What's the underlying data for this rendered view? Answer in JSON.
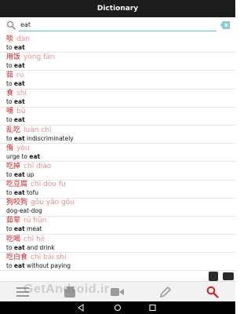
{
  "app": {
    "title": "Dictionary"
  },
  "search": {
    "value": "eat",
    "placeholder": ""
  },
  "colors": {
    "accent": "#d02020",
    "pinyin": "#e89090",
    "underline": "#55c0d8",
    "active_tab": "#d02020"
  },
  "entries": [
    {
      "hanzi": "啖",
      "pinyin": "dàn",
      "gloss_pre": "to ",
      "gloss_key": "eat",
      "gloss_post": ""
    },
    {
      "hanzi": "用饭",
      "pinyin": "yòng fàn",
      "gloss_pre": "to ",
      "gloss_key": "eat",
      "gloss_post": ""
    },
    {
      "hanzi": "茹",
      "pinyin": "rú",
      "gloss_pre": "to ",
      "gloss_key": "eat",
      "gloss_post": ""
    },
    {
      "hanzi": "食",
      "pinyin": "shí",
      "gloss_pre": "to ",
      "gloss_key": "eat",
      "gloss_post": ""
    },
    {
      "hanzi": "哺",
      "pinyin": "bǔ",
      "gloss_pre": "to ",
      "gloss_key": "eat",
      "gloss_post": ""
    },
    {
      "hanzi": "乱吃",
      "pinyin": "luàn chī",
      "gloss_pre": "to ",
      "gloss_key": "eat",
      "gloss_post": " indiscriminately"
    },
    {
      "hanzi": "侑",
      "pinyin": "yòu",
      "gloss_pre": "urge to ",
      "gloss_key": "eat",
      "gloss_post": ""
    },
    {
      "hanzi": "吃掉",
      "pinyin": "chī diào",
      "gloss_pre": "to ",
      "gloss_key": "eat",
      "gloss_post": " up"
    },
    {
      "hanzi": "吃豆腐",
      "pinyin": "chī dòu fu",
      "gloss_pre": "to ",
      "gloss_key": "eat",
      "gloss_post": " tofu"
    },
    {
      "hanzi": "狗咬狗",
      "pinyin": "gǒu yǎo gǒu",
      "gloss_pre": "dog-eat-dog",
      "gloss_key": "",
      "gloss_post": ""
    },
    {
      "hanzi": "茹荤",
      "pinyin": "rú hūn",
      "gloss_pre": "to ",
      "gloss_key": "eat",
      "gloss_post": " meat"
    },
    {
      "hanzi": "吃喝",
      "pinyin": "chī hē",
      "gloss_pre": "to ",
      "gloss_key": "eat",
      "gloss_post": " and drink"
    },
    {
      "hanzi": "吃白食",
      "pinyin": "chī bái shí",
      "gloss_pre": "to ",
      "gloss_key": "eat",
      "gloss_post": " without paying"
    }
  ],
  "tabs": [
    {
      "name": "tab-list",
      "icon": "list-icon"
    },
    {
      "name": "tab-flashcards",
      "icon": "cards-icon"
    },
    {
      "name": "tab-video",
      "icon": "video-icon"
    },
    {
      "name": "tab-write",
      "icon": "pencil-icon"
    },
    {
      "name": "tab-search",
      "icon": "search-icon",
      "active": true
    }
  ],
  "watermark": {
    "text": "GetAndroid.ir"
  }
}
